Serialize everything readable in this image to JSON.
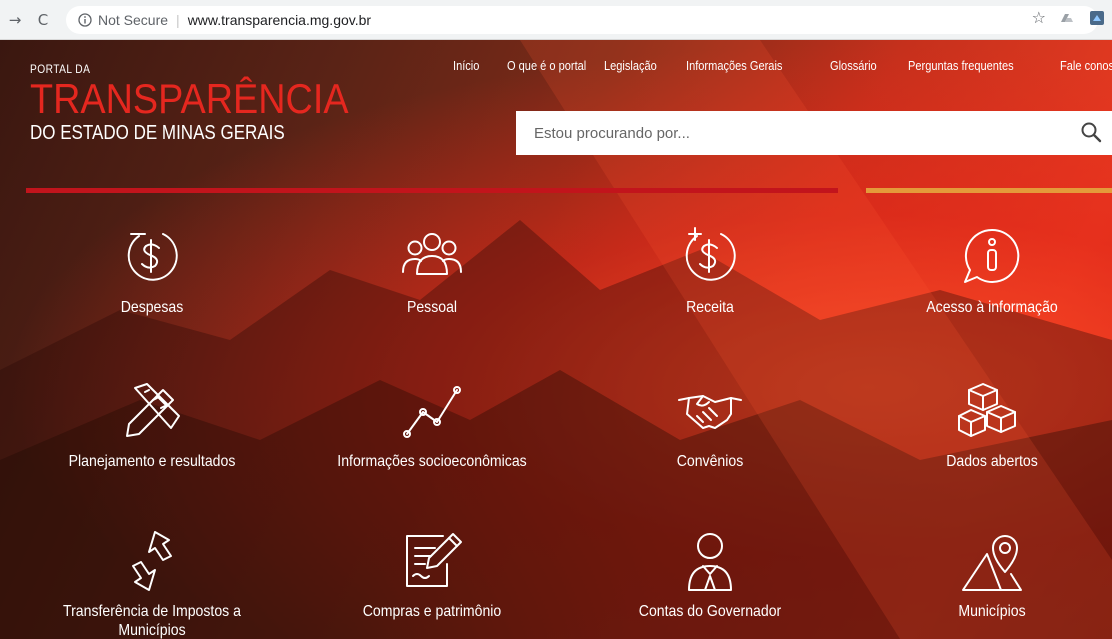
{
  "browser": {
    "security_label": "Not Secure",
    "url": "www.transparencia.mg.gov.br"
  },
  "logo": {
    "line1": "PORTAL DA",
    "line2": "TRANSPARÊNCIA",
    "line3": "DO ESTADO DE MINAS GERAIS"
  },
  "nav": [
    {
      "label": "Início"
    },
    {
      "label": "O que é o portal"
    },
    {
      "label": "Legislação"
    },
    {
      "label": "Informações Gerais"
    },
    {
      "label": "Glossário"
    },
    {
      "label": "Perguntas frequentes"
    },
    {
      "label": "Fale conosco"
    }
  ],
  "search": {
    "placeholder": "Estou procurando por..."
  },
  "tiles": [
    {
      "label": "Despesas",
      "icon": "money-minus-icon"
    },
    {
      "label": "Pessoal",
      "icon": "people-icon"
    },
    {
      "label": "Receita",
      "icon": "money-plus-icon"
    },
    {
      "label": "Acesso à informação",
      "icon": "info-bubble-icon"
    },
    {
      "label": "Planejamento e resultados",
      "icon": "pencil-ruler-icon"
    },
    {
      "label": "Informações socioeconômicas",
      "icon": "line-chart-icon"
    },
    {
      "label": "Convênios",
      "icon": "handshake-icon"
    },
    {
      "label": "Dados abertos",
      "icon": "cubes-icon"
    },
    {
      "label": "Transferência de Impostos a Municípios",
      "icon": "transfer-arrows-icon"
    },
    {
      "label": "Compras e patrimônio",
      "icon": "document-pen-icon"
    },
    {
      "label": "Contas do Governador",
      "icon": "governor-icon"
    },
    {
      "label": "Municípios",
      "icon": "map-pin-icon"
    }
  ],
  "colors": {
    "accent_red": "#e5271f",
    "line_red": "#c2141c",
    "line_orange": "#e49a3a"
  }
}
